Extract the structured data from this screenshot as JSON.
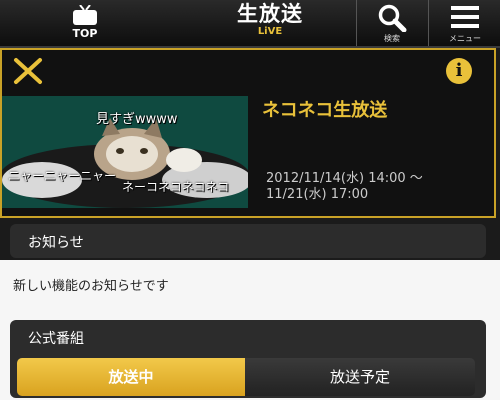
{
  "header": {
    "top_label": "TOP",
    "brand_main": "生放送",
    "brand_sub": "LiVE",
    "search_label": "検索",
    "menu_label": "メニュー"
  },
  "program": {
    "title": "ネコネコ生放送",
    "date_line1": "2012/11/14(水) 14:00 ～",
    "date_line2": "11/21(水) 17:00",
    "thumb_captions": [
      "見すぎwwww",
      "ニャーニャーニャー",
      "ネーコネコネコネコ"
    ]
  },
  "notice": {
    "title": "お知らせ",
    "body": "新しい機能のお知らせです"
  },
  "official": {
    "title": "公式番組",
    "tabs": [
      {
        "label": "放送中",
        "active": true
      },
      {
        "label": "放送予定",
        "active": false
      }
    ]
  },
  "icons": {
    "top": "tv-icon",
    "search": "search-icon",
    "menu": "hamburger-menu-icon",
    "close": "close-icon",
    "info": "info-icon"
  },
  "colors": {
    "accent": "#e9c13a",
    "frame": "#c9a227",
    "background": "#1b1b1b"
  }
}
